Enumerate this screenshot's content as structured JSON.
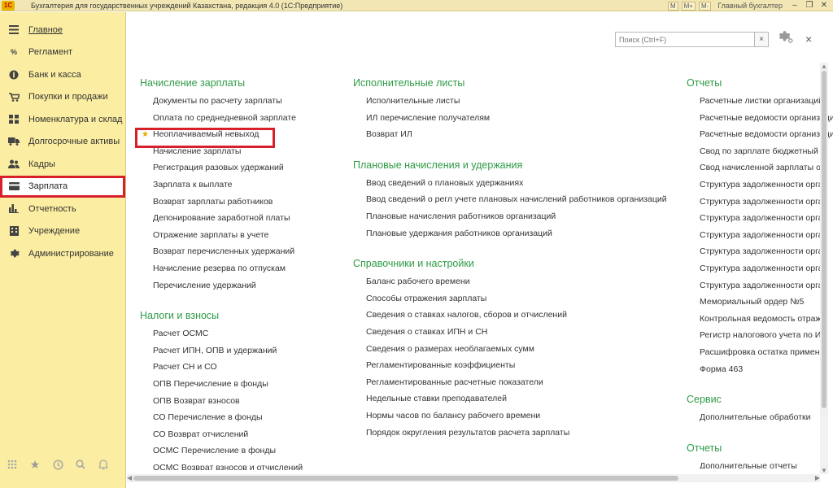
{
  "window": {
    "title": "Бухгалтерия для государственных учреждений Казахстана, редакция 4.0  (1С:Предприятие)",
    "logo": "1С",
    "toolbar": [
      "M",
      "M+",
      "M-"
    ],
    "user": "Главный бухгалтер"
  },
  "sidebar": {
    "items": [
      {
        "label": "Главное",
        "icon": "menu-icon"
      },
      {
        "label": "Регламент",
        "icon": "regulation-icon"
      },
      {
        "label": "Банк и касса",
        "icon": "coin-icon"
      },
      {
        "label": "Покупки и продажи",
        "icon": "cart-icon"
      },
      {
        "label": "Номенклатура и склад",
        "icon": "warehouse-icon"
      },
      {
        "label": "Долгосрочные активы",
        "icon": "truck-icon"
      },
      {
        "label": "Кадры",
        "icon": "people-icon"
      },
      {
        "label": "Зарплата",
        "icon": "card-icon"
      },
      {
        "label": "Отчетность",
        "icon": "bar-chart-icon"
      },
      {
        "label": "Учреждение",
        "icon": "building-icon"
      },
      {
        "label": "Администрирование",
        "icon": "gear-icon"
      }
    ]
  },
  "search": {
    "placeholder": "Поиск (Ctrl+F)",
    "clear": "×"
  },
  "close_label": "×",
  "columns": {
    "col1": {
      "sections": [
        {
          "title": "Начисление зарплаты",
          "links": [
            "Документы по расчету зарплаты",
            "Оплата по среднедневной зарплате",
            "Неоплачиваемый невыход",
            "Начисление зарплаты",
            "Регистрация разовых удержаний",
            "Зарплата к выплате",
            "Возврат зарплаты работников",
            "Депонирование заработной платы",
            "Отражение зарплаты в учете",
            "Возврат перечисленных удержаний",
            "Начисление резерва по отпускам",
            "Перечисление удержаний"
          ]
        },
        {
          "title": "Налоги и взносы",
          "links": [
            "Расчет ОСМС",
            "Расчет ИПН, ОПВ и удержаний",
            "Расчет СН и СО",
            "ОПВ Перечисление в фонды",
            "ОПВ Возврат взносов",
            "СО Перечисление в фонды",
            "СО Возврат отчислений",
            "ОСМС Перечисление в фонды",
            "ОСМС Возврат взносов и отчислений"
          ]
        }
      ]
    },
    "col2": {
      "sections": [
        {
          "title": "Исполнительные листы",
          "links": [
            "Исполнительные листы",
            "ИЛ перечисление получателям",
            "Возврат ИЛ"
          ]
        },
        {
          "title": "Плановые начисления и удержания",
          "links": [
            "Ввод сведений о плановых удержаниях",
            "Ввод сведений о регл учете плановых начислений работников организаций",
            "Плановые начисления работников организаций",
            "Плановые удержания работников организаций"
          ]
        },
        {
          "title": "Справочники и настройки",
          "links": [
            "Баланс рабочего времени",
            "Способы отражения зарплаты",
            "Сведения о ставках налогов, сборов и отчислений",
            "Сведения о ставках ИПН и СН",
            "Сведения о размерах необлагаемых сумм",
            "Регламентированные коэффициенты",
            "Регламентированные расчетные показатели",
            "Недельные ставки преподавателей",
            "Нормы часов по балансу рабочего времени",
            "Порядок округления результатов расчета зарплаты"
          ]
        }
      ]
    },
    "col3": {
      "sections": [
        {
          "title": "Отчеты",
          "links": [
            "Расчетные листки организаций",
            "Расчетные ведомости организаций",
            "Расчетные ведомости организаций",
            "Свод по зарплате бюджетный",
            "Свод начисленной зарплаты о",
            "Структура задолженности орга",
            "Структура задолженности орга",
            "Структура задолженности орга",
            "Структура задолженности орга",
            "Структура задолженности орга",
            "Структура задолженности орга",
            "Структура задолженности орга",
            "Мемориальный ордер №5",
            "Контрольная ведомость отраж",
            "Регистр налогового учета по И",
            "Расшифровка остатка примене",
            "Форма 463"
          ]
        },
        {
          "title": "Сервис",
          "links": [
            "Дополнительные обработки"
          ]
        },
        {
          "title": "Отчеты",
          "links": [
            "Дополнительные отчеты"
          ]
        }
      ]
    }
  },
  "favorite_item": "Неоплачиваемый невыход",
  "highlight": {
    "sidebar": "Зарплата",
    "link": "Неоплачиваемый невыход",
    "color": "#d7202a"
  },
  "colors": {
    "section_title": "#2f9b46",
    "sidebar_bg": "#fbeda1",
    "star": "#e8a800"
  }
}
